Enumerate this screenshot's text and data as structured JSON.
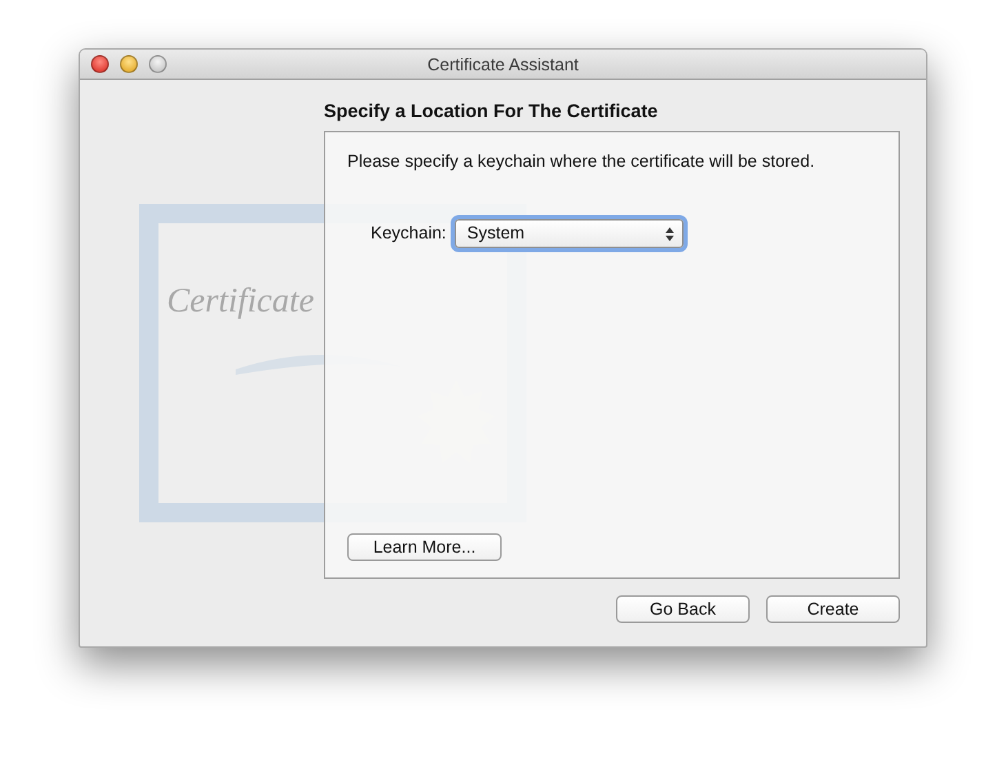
{
  "window": {
    "title": "Certificate Assistant",
    "controls": [
      {
        "kind": "close"
      },
      {
        "kind": "minimize"
      },
      {
        "kind": "zoom"
      }
    ]
  },
  "artwork": {
    "caption": "Certificate"
  },
  "heading": "Specify a Location For The Certificate",
  "panel": {
    "instruction": "Please specify a keychain where the certificate will be stored.",
    "keychain": {
      "label": "Keychain:",
      "value": "System",
      "focused": true
    },
    "help_button": "Learn More..."
  },
  "buttons": [
    "Go Back",
    "Create"
  ]
}
